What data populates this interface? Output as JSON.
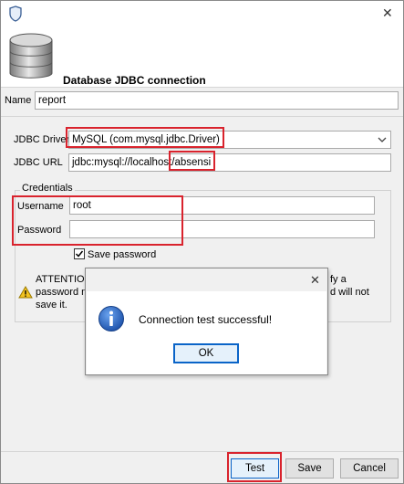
{
  "window": {
    "title_icon": "app-shield-icon",
    "close_glyph": "✕"
  },
  "header": {
    "title": "Database JDBC connection",
    "icon": "database-icon"
  },
  "form": {
    "name_label": "Name",
    "name_value": "report",
    "driver_label": "JDBC Driver",
    "driver_value": "MySQL (com.mysql.jdbc.Driver)",
    "url_label": "JDBC URL",
    "url_value": "jdbc:mysql://localhost/",
    "url_highlight": "absensi",
    "credentials_title": "Credentials",
    "username_label": "Username",
    "username_value": "root",
    "password_label": "Password",
    "password_value": "",
    "save_password_label": "Save password",
    "save_password_checked": true,
    "attention_left_1": "ATTENTION",
    "attention_left_2": "password n",
    "attention_left_3": "save it.",
    "attention_right_1": "fy a",
    "attention_right_2": "d will not"
  },
  "dialog": {
    "title_close_glyph": "✕",
    "message": "Connection test successful!",
    "ok_label": "OK",
    "icon": "info-icon"
  },
  "buttons": {
    "test_label": "Test",
    "save_label": "Save",
    "cancel_label": "Cancel"
  },
  "colors": {
    "highlight_red": "#d9232d",
    "info_blue": "#1f5fbf"
  }
}
